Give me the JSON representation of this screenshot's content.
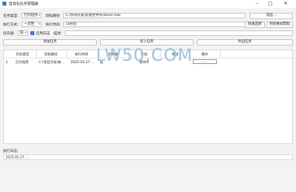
{
  "window": {
    "title": "自动化任务管理器"
  },
  "form": {
    "task_type_label": "任务类型:",
    "task_type_value": "打开程序",
    "target_path_label": "目标路径:",
    "target_path_value": "C:/项目开发/新建文件夹/diss/c.exe",
    "browse_label": "浏览...",
    "exec_mode_label": "执行方式:",
    "exec_mode_value": "一次性",
    "exec_time_label": "执行时间:",
    "exec_time_value": "10秒后",
    "quick_select_label": "快速选择",
    "time_format_help_label": "时间格式帮助",
    "priority_label": "优先级:",
    "priority_value": "低",
    "enable_log_label": "启用日志",
    "description_label": "描述:",
    "description_value": ""
  },
  "actions": {
    "add_task": "添加任务",
    "import_tasks": "导入任务",
    "export_tasks": "导出任务"
  },
  "table": {
    "headers": [
      "任务类型",
      "目标路径",
      "执行时间",
      "优先级",
      "状态",
      "描述",
      "操作"
    ],
    "rows": [
      {
        "index": "1",
        "type": "打开程序",
        "path": "C:/项目开发/新...",
        "time": "2025-01-27 ...",
        "priority": "低",
        "status": "等待中",
        "description": "",
        "operation": "......"
      }
    ]
  },
  "watermark": "LW50.COM",
  "log": {
    "label": "执行日志:",
    "text": "2025-01-27 ..."
  }
}
